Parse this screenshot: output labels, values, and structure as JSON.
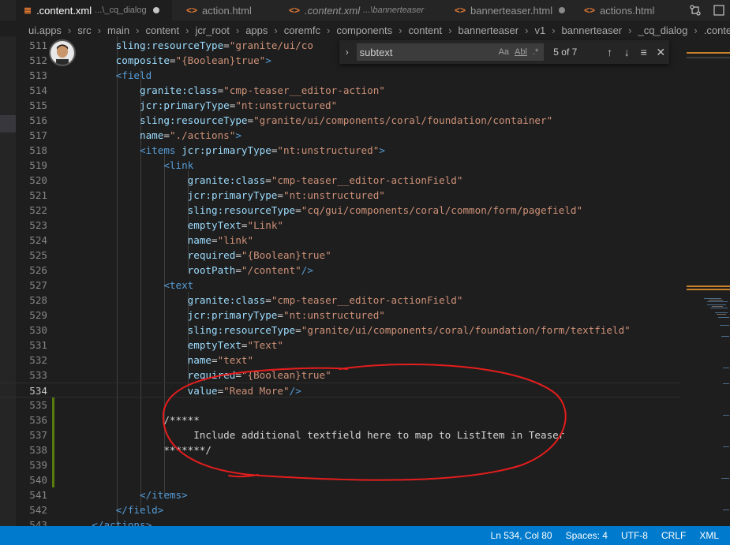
{
  "tabs": [
    {
      "name": ".content.xml",
      "desc": "...\\_cq_dialog",
      "active": true,
      "dirty": true,
      "italic": false,
      "icon": "rss-icon"
    },
    {
      "name": "action.html",
      "desc": "",
      "active": false,
      "dirty": false,
      "italic": false,
      "icon": "code-icon"
    },
    {
      "name": ".content.xml",
      "desc": "...\\bannerteaser",
      "active": false,
      "dirty": false,
      "italic": true,
      "icon": "code-icon"
    },
    {
      "name": "bannerteaser.html",
      "desc": "",
      "active": false,
      "dirty": true,
      "italic": false,
      "icon": "code-icon"
    },
    {
      "name": "actions.html",
      "desc": "",
      "active": false,
      "dirty": false,
      "italic": false,
      "icon": "code-icon"
    }
  ],
  "breadcrumb": [
    "ui.apps",
    "src",
    "main",
    "content",
    "jcr_root",
    "apps",
    "coremfc",
    "components",
    "content",
    "bannerteaser",
    "v1",
    "bannerteaser",
    "_cq_dialog",
    ".content.xml"
  ],
  "find": {
    "value": "subtext",
    "options": [
      "Aa",
      "Abl",
      ".*"
    ],
    "count": "5 of 7"
  },
  "code_lines": [
    {
      "n": "511",
      "indent": 0,
      "tokens": [
        [
          "txt",
          "        "
        ],
        [
          "attr",
          "sling:resourceType"
        ],
        [
          "txt",
          "="
        ],
        [
          "str",
          "\"granite/ui/co"
        ]
      ]
    },
    {
      "n": "512",
      "indent": 0,
      "tokens": [
        [
          "txt",
          "        "
        ],
        [
          "attr",
          "composite"
        ],
        [
          "txt",
          "="
        ],
        [
          "str",
          "\"{Boolean}true\""
        ],
        [
          "tag",
          ">"
        ]
      ]
    },
    {
      "n": "513",
      "indent": 0,
      "tokens": [
        [
          "txt",
          "        "
        ],
        [
          "tag",
          "<field"
        ]
      ]
    },
    {
      "n": "514",
      "indent": 0,
      "tokens": [
        [
          "txt",
          "            "
        ],
        [
          "attr",
          "granite:class"
        ],
        [
          "txt",
          "="
        ],
        [
          "str",
          "\"cmp-teaser__editor-action\""
        ]
      ]
    },
    {
      "n": "515",
      "indent": 0,
      "tokens": [
        [
          "txt",
          "            "
        ],
        [
          "attr",
          "jcr:primaryType"
        ],
        [
          "txt",
          "="
        ],
        [
          "str",
          "\"nt:unstructured\""
        ]
      ]
    },
    {
      "n": "516",
      "indent": 0,
      "tokens": [
        [
          "txt",
          "            "
        ],
        [
          "attr",
          "sling:resourceType"
        ],
        [
          "txt",
          "="
        ],
        [
          "str",
          "\"granite/ui/components/coral/foundation/container\""
        ]
      ]
    },
    {
      "n": "517",
      "indent": 0,
      "tokens": [
        [
          "txt",
          "            "
        ],
        [
          "attr",
          "name"
        ],
        [
          "txt",
          "="
        ],
        [
          "str",
          "\"./actions\""
        ],
        [
          "tag",
          ">"
        ]
      ]
    },
    {
      "n": "518",
      "indent": 0,
      "tokens": [
        [
          "txt",
          "            "
        ],
        [
          "tag",
          "<items "
        ],
        [
          "attr",
          "jcr:primaryType"
        ],
        [
          "txt",
          "="
        ],
        [
          "str",
          "\"nt:unstructured\""
        ],
        [
          "tag",
          ">"
        ]
      ]
    },
    {
      "n": "519",
      "indent": 0,
      "tokens": [
        [
          "txt",
          "                "
        ],
        [
          "tag",
          "<link"
        ]
      ]
    },
    {
      "n": "520",
      "indent": 0,
      "tokens": [
        [
          "txt",
          "                    "
        ],
        [
          "attr",
          "granite:class"
        ],
        [
          "txt",
          "="
        ],
        [
          "str",
          "\"cmp-teaser__editor-actionField\""
        ]
      ]
    },
    {
      "n": "521",
      "indent": 0,
      "tokens": [
        [
          "txt",
          "                    "
        ],
        [
          "attr",
          "jcr:primaryType"
        ],
        [
          "txt",
          "="
        ],
        [
          "str",
          "\"nt:unstructured\""
        ]
      ]
    },
    {
      "n": "522",
      "indent": 0,
      "tokens": [
        [
          "txt",
          "                    "
        ],
        [
          "attr",
          "sling:resourceType"
        ],
        [
          "txt",
          "="
        ],
        [
          "str",
          "\"cq/gui/components/coral/common/form/pagefield\""
        ]
      ]
    },
    {
      "n": "523",
      "indent": 0,
      "tokens": [
        [
          "txt",
          "                    "
        ],
        [
          "attr",
          "emptyText"
        ],
        [
          "txt",
          "="
        ],
        [
          "str",
          "\"Link\""
        ]
      ]
    },
    {
      "n": "524",
      "indent": 0,
      "tokens": [
        [
          "txt",
          "                    "
        ],
        [
          "attr",
          "name"
        ],
        [
          "txt",
          "="
        ],
        [
          "str",
          "\"link\""
        ]
      ]
    },
    {
      "n": "525",
      "indent": 0,
      "tokens": [
        [
          "txt",
          "                    "
        ],
        [
          "attr",
          "required"
        ],
        [
          "txt",
          "="
        ],
        [
          "str",
          "\"{Boolean}true\""
        ]
      ]
    },
    {
      "n": "526",
      "indent": 0,
      "tokens": [
        [
          "txt",
          "                    "
        ],
        [
          "attr",
          "rootPath"
        ],
        [
          "txt",
          "="
        ],
        [
          "str",
          "\"/content\""
        ],
        [
          "tag",
          "/>"
        ]
      ]
    },
    {
      "n": "527",
      "indent": 0,
      "tokens": [
        [
          "txt",
          "                "
        ],
        [
          "tag",
          "<text"
        ]
      ]
    },
    {
      "n": "528",
      "indent": 0,
      "tokens": [
        [
          "txt",
          "                    "
        ],
        [
          "attr",
          "granite:class"
        ],
        [
          "txt",
          "="
        ],
        [
          "str",
          "\"cmp-teaser__editor-actionField\""
        ]
      ]
    },
    {
      "n": "529",
      "indent": 0,
      "tokens": [
        [
          "txt",
          "                    "
        ],
        [
          "attr",
          "jcr:primaryType"
        ],
        [
          "txt",
          "="
        ],
        [
          "str",
          "\"nt:unstructured\""
        ]
      ]
    },
    {
      "n": "530",
      "indent": 0,
      "tokens": [
        [
          "txt",
          "                    "
        ],
        [
          "attr",
          "sling:resourceType"
        ],
        [
          "txt",
          "="
        ],
        [
          "str",
          "\"granite/ui/components/coral/foundation/form/textfield\""
        ]
      ]
    },
    {
      "n": "531",
      "indent": 0,
      "tokens": [
        [
          "txt",
          "                    "
        ],
        [
          "attr",
          "emptyText"
        ],
        [
          "txt",
          "="
        ],
        [
          "str",
          "\"Text\""
        ]
      ]
    },
    {
      "n": "532",
      "indent": 0,
      "tokens": [
        [
          "txt",
          "                    "
        ],
        [
          "attr",
          "name"
        ],
        [
          "txt",
          "="
        ],
        [
          "str",
          "\"text\""
        ]
      ]
    },
    {
      "n": "533",
      "indent": 0,
      "tokens": [
        [
          "txt",
          "                    "
        ],
        [
          "attr",
          "required"
        ],
        [
          "txt",
          "="
        ],
        [
          "str",
          "\"{Boolean}true\""
        ]
      ]
    },
    {
      "n": "534",
      "indent": 0,
      "tokens": [
        [
          "txt",
          "                    "
        ],
        [
          "attr",
          "value"
        ],
        [
          "txt",
          "="
        ],
        [
          "str",
          "\"Read More\""
        ],
        [
          "tag",
          "/>"
        ]
      ]
    },
    {
      "n": "535",
      "indent": 0,
      "tokens": [
        [
          "txt",
          ""
        ]
      ]
    },
    {
      "n": "536",
      "indent": 0,
      "tokens": [
        [
          "txt",
          "                /*****"
        ]
      ]
    },
    {
      "n": "537",
      "indent": 0,
      "tokens": [
        [
          "txt",
          "                     Include additional textfield here to map to ListItem in Teaser"
        ]
      ]
    },
    {
      "n": "538",
      "indent": 0,
      "tokens": [
        [
          "txt",
          "                *******/"
        ]
      ]
    },
    {
      "n": "539",
      "indent": 0,
      "tokens": [
        [
          "txt",
          ""
        ]
      ]
    },
    {
      "n": "540",
      "indent": 0,
      "tokens": [
        [
          "txt",
          ""
        ]
      ]
    },
    {
      "n": "541",
      "indent": 0,
      "tokens": [
        [
          "txt",
          "            "
        ],
        [
          "tag",
          "</items>"
        ]
      ]
    },
    {
      "n": "542",
      "indent": 0,
      "tokens": [
        [
          "txt",
          "        "
        ],
        [
          "tag",
          "</field>"
        ]
      ]
    },
    {
      "n": "543",
      "indent": 0,
      "tokens": [
        [
          "txt",
          "    "
        ],
        [
          "tag",
          "</actions>"
        ]
      ]
    }
  ],
  "current_line": "534",
  "modified_lines": [
    "535",
    "536",
    "537",
    "538",
    "539",
    "540"
  ],
  "status": {
    "position": "Ln 534, Col 80",
    "spaces": "Spaces: 4",
    "encoding": "UTF-8",
    "eol": "CRLF",
    "language": "XML"
  },
  "colors": {
    "tag": "#569cd6",
    "attribute": "#9cdcfe",
    "string": "#ce9178",
    "annotation": "#e51d1d",
    "status_bar": "#007acc"
  }
}
